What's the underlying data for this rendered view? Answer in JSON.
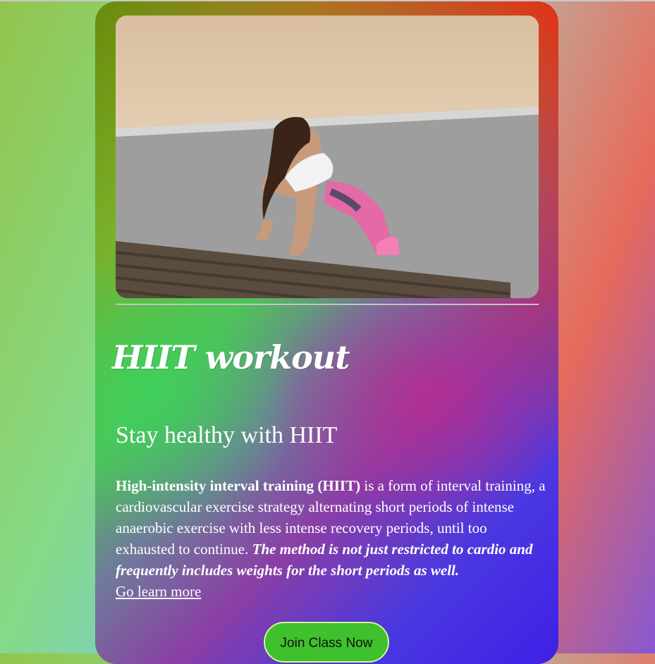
{
  "hero": {
    "alt": "Woman doing push-ups on a bench by the beach"
  },
  "card": {
    "title": "HIIT workout",
    "subtitle": "Stay healthy with HIIT",
    "intro_bold": "High-intensity interval training (HIIT)",
    "intro_text": " is a form of interval training, a cardiovascular exercise strategy alternating short periods of intense anaerobic exercise with less intense recovery periods, until too exhausted to continue. ",
    "emphasis": "The method is not just restricted to cardio and frequently includes weights for the short periods as well.",
    "link_label": "Go learn more",
    "button_label": "Join Class Now"
  },
  "colors": {
    "button": "#3ec12c",
    "text": "#ffffff"
  }
}
